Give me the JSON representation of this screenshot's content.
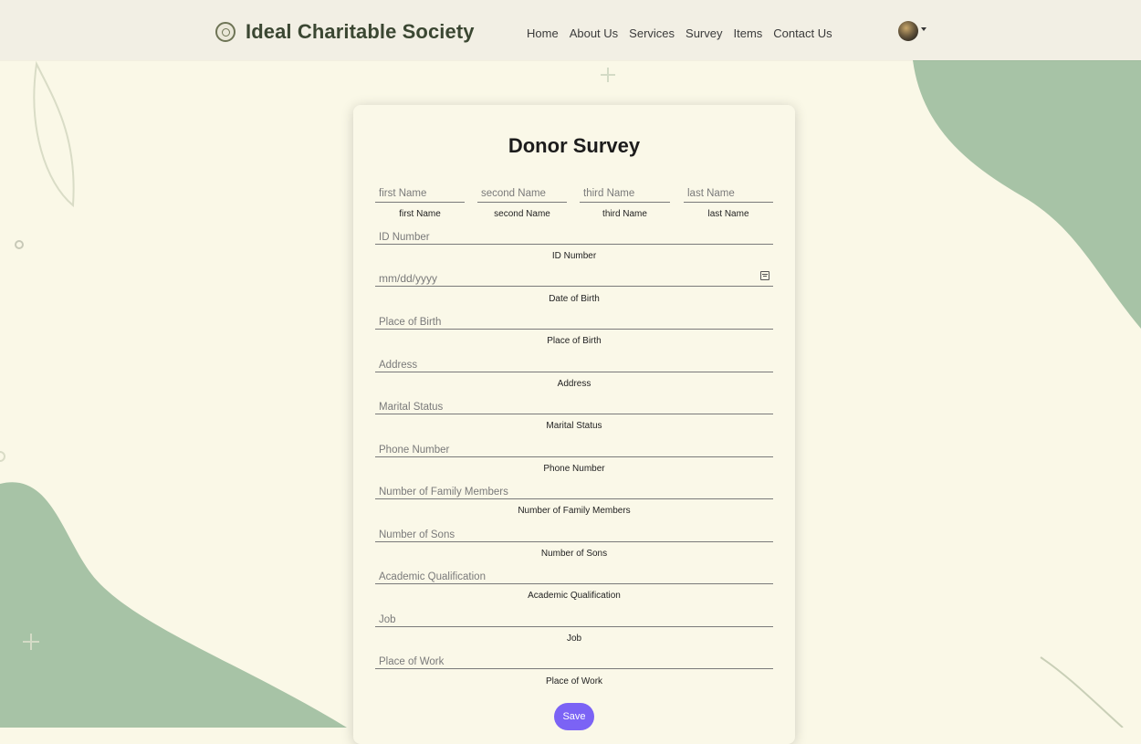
{
  "navbar": {
    "brand": "Ideal Charitable Society",
    "links": [
      "Home",
      "About Us",
      "Services",
      "Survey",
      "Items",
      "Contact Us"
    ]
  },
  "form": {
    "title": "Donor Survey",
    "name_fields": [
      {
        "placeholder": "first Name",
        "label": "first Name"
      },
      {
        "placeholder": "second Name",
        "label": "second Name"
      },
      {
        "placeholder": "third Name",
        "label": "third Name"
      },
      {
        "placeholder": "last Name",
        "label": "last Name"
      }
    ],
    "fields": [
      {
        "placeholder": "ID Number",
        "label": "ID Number"
      },
      {
        "placeholder": "mm/dd/yyyy",
        "label": "Date of Birth"
      },
      {
        "placeholder": "Place of Birth",
        "label": "Place of Birth"
      },
      {
        "placeholder": "Address",
        "label": "Address"
      },
      {
        "placeholder": "Marital Status",
        "label": "Marital Status"
      },
      {
        "placeholder": "Phone Number",
        "label": "Phone Number"
      },
      {
        "placeholder": "Number of Family Members",
        "label": "Number of Family Members"
      },
      {
        "placeholder": "Number of Sons",
        "label": "Number of Sons"
      },
      {
        "placeholder": "Academic Qualification",
        "label": "Academic Qualification"
      },
      {
        "placeholder": "Job",
        "label": "Job"
      },
      {
        "placeholder": "Place of Work",
        "label": "Place of Work"
      }
    ],
    "save_label": "Save"
  },
  "colors": {
    "background": "#faf8e7",
    "navbar": "#f2efe4",
    "shape_green": "#a7c3a6",
    "brand_text": "#3b4732",
    "save_button": "#7b63f5"
  }
}
